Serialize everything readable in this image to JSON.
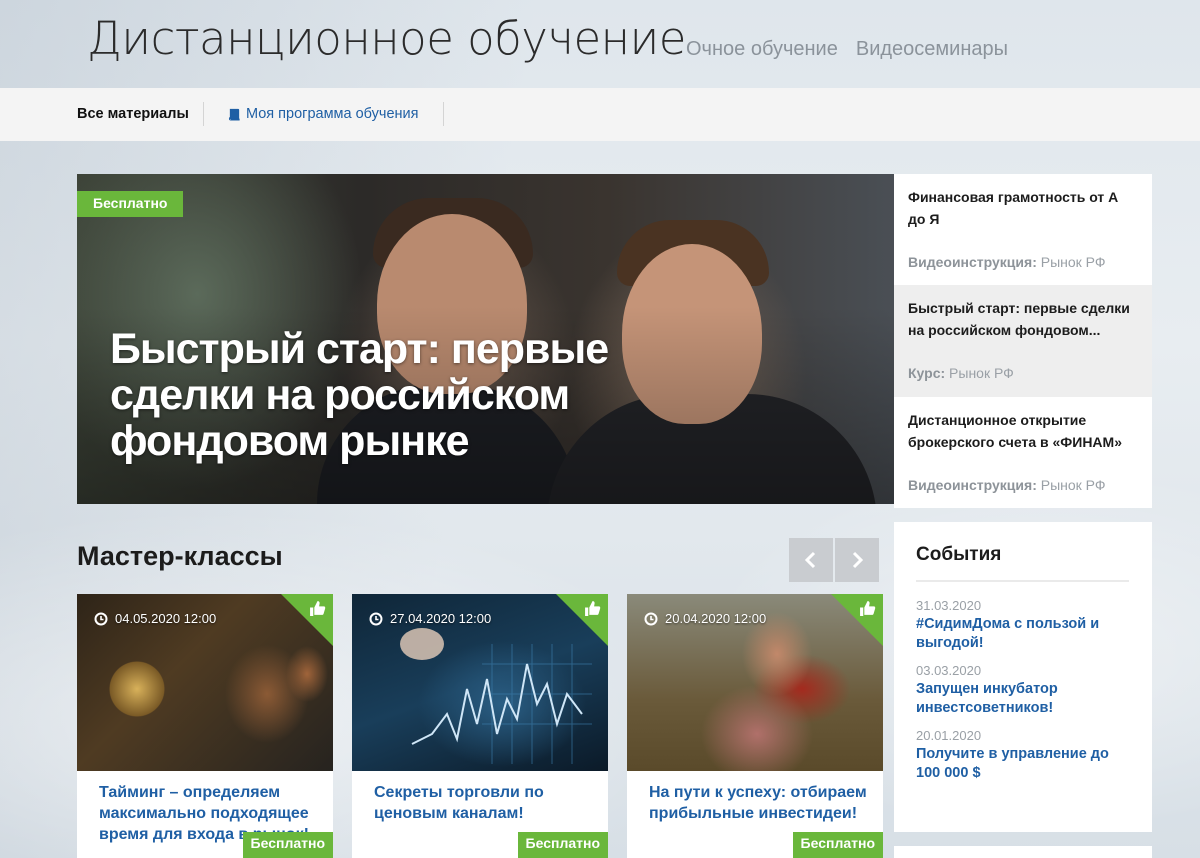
{
  "header": {
    "site_title": "Дистанционное обучение",
    "nav": [
      "Очное обучение",
      "Видеосеминары"
    ]
  },
  "subnav": {
    "all_materials": "Все материалы",
    "my_program": "Моя программа обучения"
  },
  "hero": {
    "badge": "Бесплатно",
    "title": "Быстрый старт: первые сделки на российском фондовом рынке"
  },
  "side_list": [
    {
      "title": "Финансовая грамотность от А до Я",
      "type": "Видеоинструкция:",
      "source": "Рынок РФ"
    },
    {
      "title": "Быстрый старт: первые сделки на российском фондовом...",
      "type": "Курс:",
      "source": "Рынок РФ"
    },
    {
      "title": "Дистанционное открытие брокерского счета в «ФИНАМ»",
      "type": "Видеоинструкция:",
      "source": "Рынок РФ"
    }
  ],
  "master_classes": {
    "title": "Мастер-классы",
    "cards": [
      {
        "date": "04.05.2020 12:00",
        "badge": "Бесплатно",
        "title": "Тайминг – определяем максимально подходящее время для входа в рынок!"
      },
      {
        "date": "27.04.2020 12:00",
        "badge": "Бесплатно",
        "title": "Секреты торговли по ценовым каналам!"
      },
      {
        "date": "20.04.2020 12:00",
        "badge": "Бесплатно",
        "title": "На пути к успеху: отбираем прибыльные инвестидеи!"
      }
    ]
  },
  "events": {
    "title": "События",
    "items": [
      {
        "date": "31.03.2020",
        "title": "#СидимДома с пользой и выгодой!"
      },
      {
        "date": "03.03.2020",
        "title": "Запущен инкубатор инвестсоветников!"
      },
      {
        "date": "20.01.2020",
        "title": "Получите в управление до 100 000 $"
      }
    ]
  },
  "colors": {
    "accent_green": "#6ab73b",
    "link_blue": "#1f5fa4"
  }
}
